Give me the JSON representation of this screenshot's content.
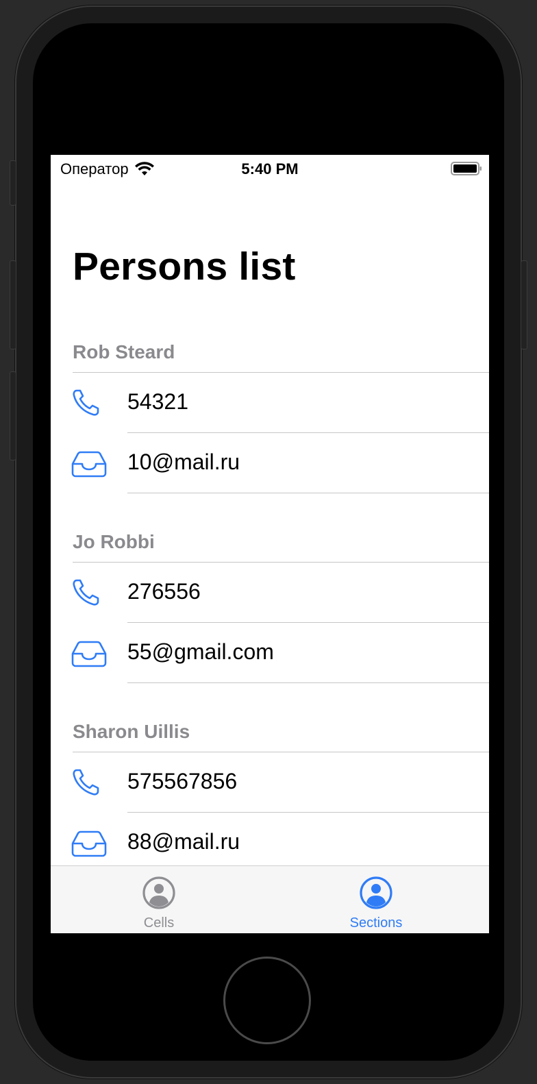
{
  "status_bar": {
    "carrier": "Оператор",
    "time": "5:40 PM"
  },
  "nav": {
    "title": "Persons list"
  },
  "sections": [
    {
      "name": "Rob Steard",
      "phone": "54321",
      "email": "10@mail.ru"
    },
    {
      "name": "Jo Robbi",
      "phone": "276556",
      "email": "55@gmail.com"
    },
    {
      "name": "Sharon Uillis",
      "phone": "575567856",
      "email": "88@mail.ru"
    }
  ],
  "tab_bar": {
    "tabs": [
      {
        "label": "Cells",
        "icon": "person-circle-icon",
        "selected": false
      },
      {
        "label": "Sections",
        "icon": "person-circle-fill-icon",
        "selected": true
      }
    ]
  },
  "colors": {
    "accent": "#2f7cf6",
    "header_gray": "#8a8a8e",
    "tab_inactive": "#8e8e93"
  }
}
